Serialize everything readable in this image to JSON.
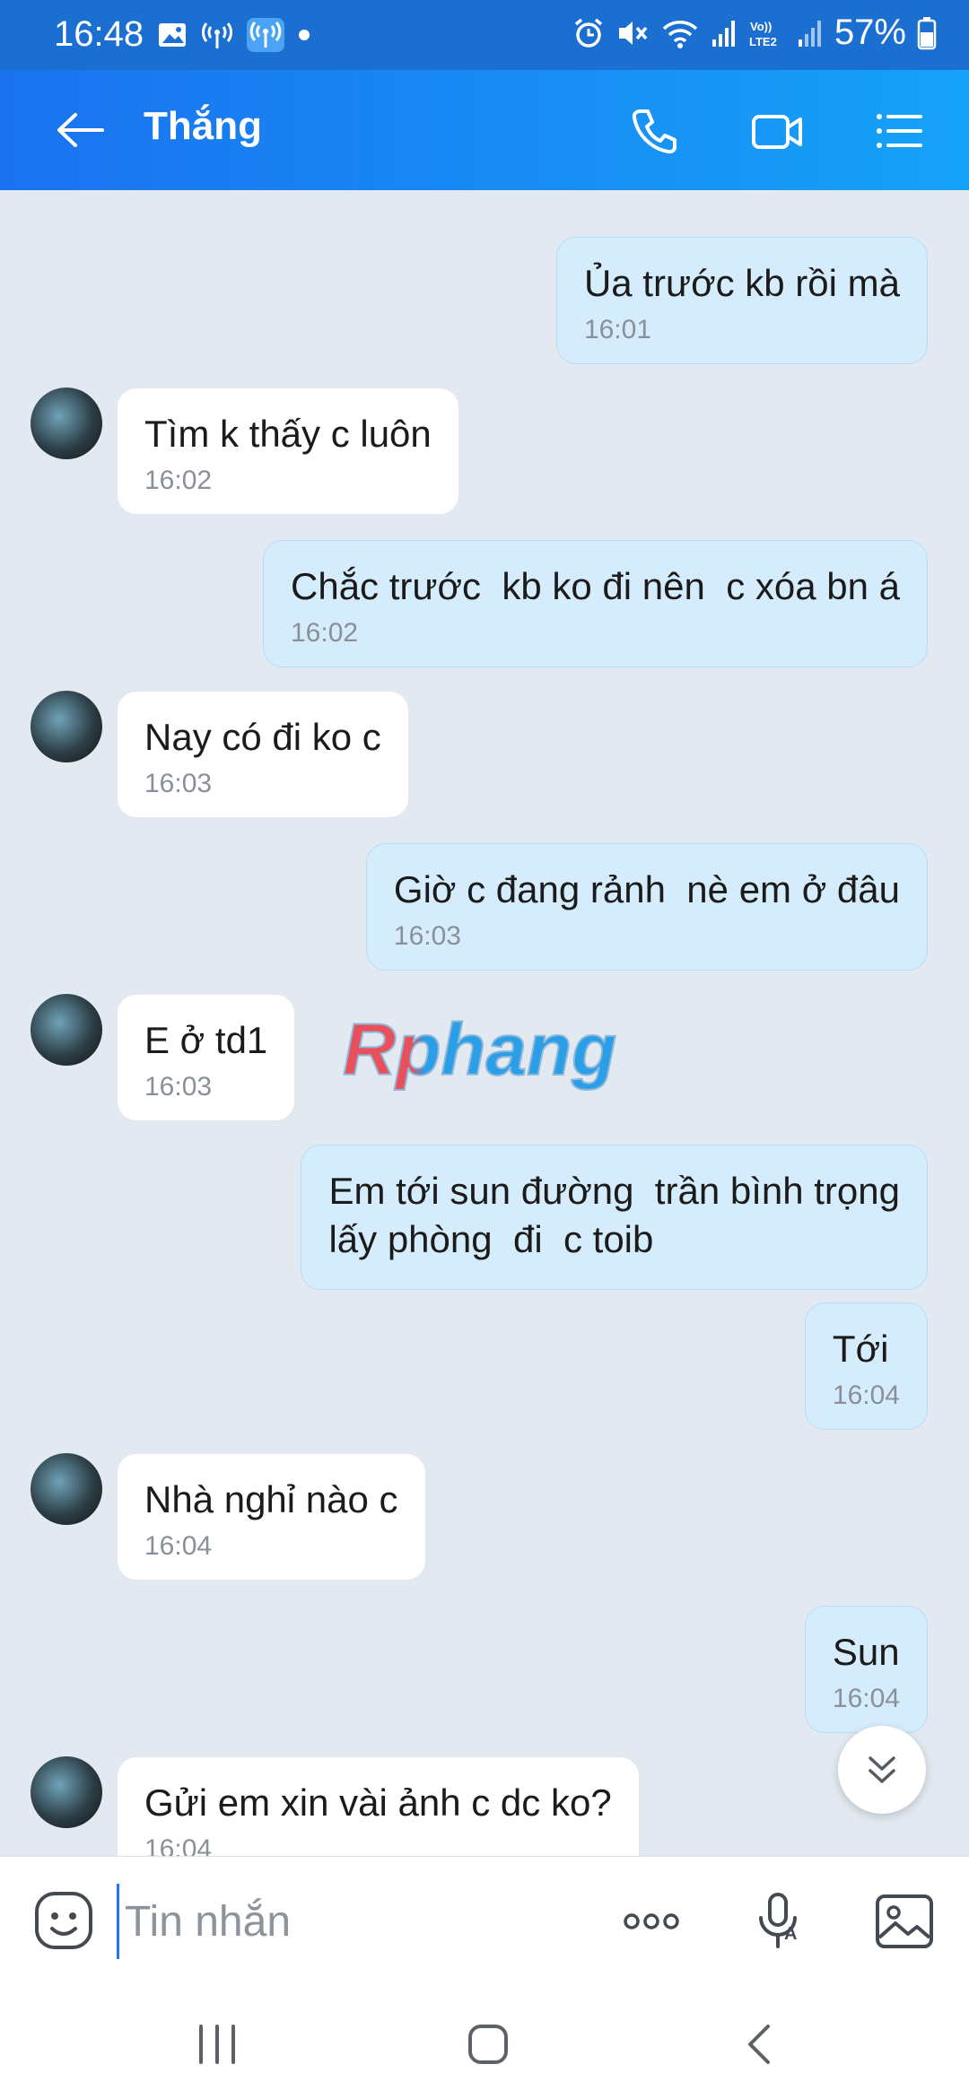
{
  "status_bar": {
    "time": "16:48",
    "battery": "57%",
    "icons_left": [
      "gallery-icon",
      "hotspot-icon",
      "hotspot-active-icon",
      "dot-icon"
    ],
    "icons_right": [
      "alarm-icon",
      "mute-icon",
      "wifi-icon",
      "signal-icon",
      "volte-icon",
      "signal-icon",
      "battery-icon"
    ]
  },
  "header": {
    "contact_name": "Thắng",
    "back_icon": "arrow-left-icon",
    "actions": [
      "phone-icon",
      "video-call-icon",
      "menu-list-icon"
    ]
  },
  "messages": [
    {
      "dir": "out",
      "text": "Ủa trước kb rồi mà",
      "time": "16:01"
    },
    {
      "dir": "in",
      "text": "Tìm k thấy c luôn",
      "time": "16:02"
    },
    {
      "dir": "out",
      "text": "Chắc trước  kb ko đi nên  c xóa bn á",
      "time": "16:02"
    },
    {
      "dir": "in",
      "text": "Nay có đi ko c",
      "time": "16:03"
    },
    {
      "dir": "out",
      "text": "Giờ c đang rảnh  nè em ở đâu",
      "time": "16:03"
    },
    {
      "dir": "in",
      "text": "E ở td1",
      "time": "16:03"
    },
    {
      "dir": "out",
      "text": "Em tới sun đường  trần bình trọng\nlấy phòng  đi  c toib",
      "time": ""
    },
    {
      "dir": "out",
      "text": "Tới",
      "time": "16:04"
    },
    {
      "dir": "in",
      "text": "Nhà nghỉ nào c",
      "time": "16:04"
    },
    {
      "dir": "out",
      "text": "Sun",
      "time": "16:04"
    },
    {
      "dir": "in",
      "text": "Gửi em xin vài ảnh c dc ko?",
      "time": "16:04"
    }
  ],
  "watermark": {
    "text": "Rphang",
    "color_start": "#e8505b",
    "color_end": "#2a9fe8"
  },
  "input_bar": {
    "placeholder": "Tin nhắn",
    "value": "",
    "actions": [
      "emoji-icon",
      "more-icon",
      "voice-text-icon",
      "image-icon"
    ]
  },
  "nav_bar": {
    "buttons": [
      "recents-icon",
      "home-icon",
      "back-icon"
    ]
  },
  "colors": {
    "accent": "#1a72f0",
    "outgoing_bubble": "#d5ecfc",
    "incoming_bubble": "#ffffff",
    "chat_bg": "#e2e9f1"
  }
}
